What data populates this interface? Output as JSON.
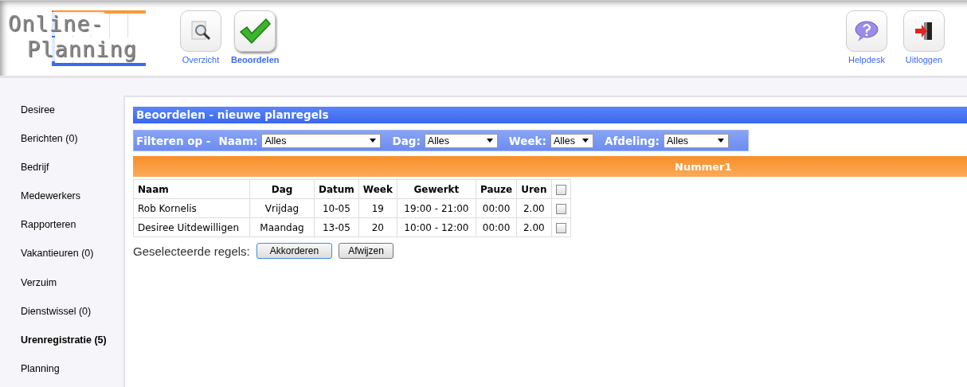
{
  "logo": {
    "line_1": "Online-",
    "line_2": "Planning"
  },
  "nav": [
    {
      "label": "Overzicht",
      "selected": false
    },
    {
      "label": "Beoordelen",
      "selected": true
    }
  ],
  "nav_right": [
    {
      "label": "Helpdesk"
    },
    {
      "label": "Uitloggen"
    }
  ],
  "sidebar": {
    "items": [
      {
        "label": "Desiree",
        "selected": false
      },
      {
        "label": "Berichten (0)",
        "selected": false
      },
      {
        "label": "Bedrijf",
        "selected": false
      },
      {
        "label": "Medewerkers",
        "selected": false
      },
      {
        "label": "Rapporteren",
        "selected": false
      },
      {
        "label": "Vakantieuren (0)",
        "selected": false
      },
      {
        "label": "Verzuim",
        "selected": false
      },
      {
        "label": "Dienstwissel (0)",
        "selected": false
      },
      {
        "label": "Urenregistratie (5)",
        "selected": true
      },
      {
        "label": "Planning",
        "selected": false
      }
    ]
  },
  "title": "Beoordelen - nieuwe planregels",
  "filter": {
    "label": "Filteren op -",
    "fields": [
      {
        "label": "Naam:",
        "value": "Alles"
      },
      {
        "label": "Dag:",
        "value": "Alles"
      },
      {
        "label": "Week:",
        "value": "Alles"
      },
      {
        "label": "Afdeling:",
        "value": "Alles"
      }
    ]
  },
  "group": "Nummer1",
  "table": {
    "columns": [
      "Naam",
      "Dag",
      "Datum",
      "Week",
      "Gewerkt",
      "Pauze",
      "Uren"
    ],
    "all_checked": false,
    "rows": [
      {
        "cells": [
          "Rob Kornelis",
          "Vrijdag",
          "10-05",
          "19",
          "19:00 - 21:00",
          "00:00",
          "2.00"
        ],
        "checked": false
      },
      {
        "cells": [
          "Desiree Uitdewilligen",
          "Maandag",
          "13-05",
          "20",
          "10:00 - 12:00",
          "00:00",
          "2.00"
        ],
        "checked": false
      }
    ]
  },
  "actions": {
    "label": "Geselecteerde regels:",
    "buttons": [
      {
        "label": "Akkorderen",
        "selected": true
      },
      {
        "label": "Afwijzen",
        "selected": false
      }
    ]
  }
}
